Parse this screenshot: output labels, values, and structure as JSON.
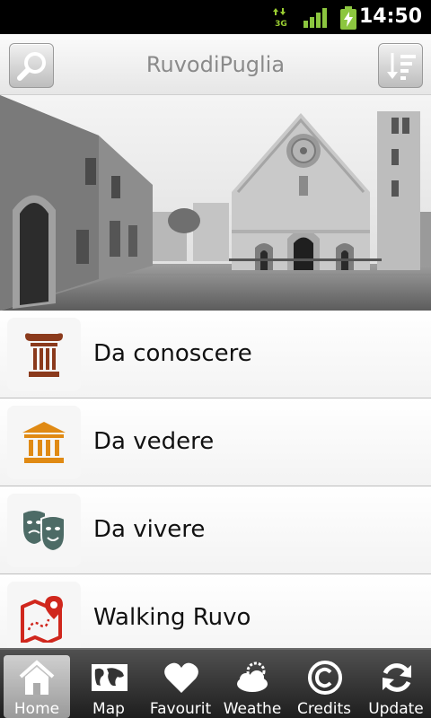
{
  "status_bar": {
    "network": "3G",
    "time": "14:50"
  },
  "header": {
    "title": "RuvodiPuglia"
  },
  "menu_items": [
    {
      "label": "Da conoscere",
      "icon": "column-icon",
      "color": "#8b3a1c"
    },
    {
      "label": "Da vedere",
      "icon": "museum-icon",
      "color": "#e08a14"
    },
    {
      "label": "Da vivere",
      "icon": "theatre-masks-icon",
      "color": "#4d6b66"
    },
    {
      "label": "Walking Ruvo",
      "icon": "route-map-icon",
      "color": "#d0271d"
    }
  ],
  "tabs": [
    {
      "label": "Home",
      "icon": "home-icon",
      "active": true
    },
    {
      "label": "Map",
      "icon": "world-map-icon"
    },
    {
      "label": "Favourit",
      "icon": "heart-icon"
    },
    {
      "label": "Weathe",
      "icon": "weather-icon"
    },
    {
      "label": "Credits",
      "icon": "copyright-icon"
    },
    {
      "label": "Update",
      "icon": "refresh-icon"
    }
  ]
}
